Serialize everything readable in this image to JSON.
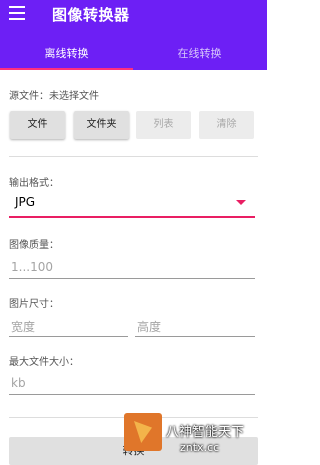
{
  "appbar": {
    "title": "图像转换器",
    "tabs": [
      {
        "label": "离线转换",
        "active": true
      },
      {
        "label": "在线转换",
        "active": false
      }
    ]
  },
  "source": {
    "label": "源文件：未选择文件",
    "buttons": [
      {
        "label": "文件",
        "enabled": true
      },
      {
        "label": "文件夹",
        "enabled": true
      },
      {
        "label": "列表",
        "enabled": false
      },
      {
        "label": "清除",
        "enabled": false
      }
    ]
  },
  "output_format": {
    "label": "输出格式：",
    "value": "JPG"
  },
  "quality": {
    "label": "图像质量：",
    "placeholder": "1...100"
  },
  "size": {
    "label": "图片尺寸：",
    "width_placeholder": "宽度",
    "height_placeholder": "高度"
  },
  "max_file_size": {
    "label": "最大文件大小：",
    "placeholder": "kb"
  },
  "convert_button": "转换",
  "watermark": {
    "line1": "八神智能天下",
    "line2": "zntx.cc"
  },
  "colors": {
    "appbar": "#6d1ff5",
    "accent": "#e91e63",
    "tab_indicator": "#ff2f7d"
  }
}
